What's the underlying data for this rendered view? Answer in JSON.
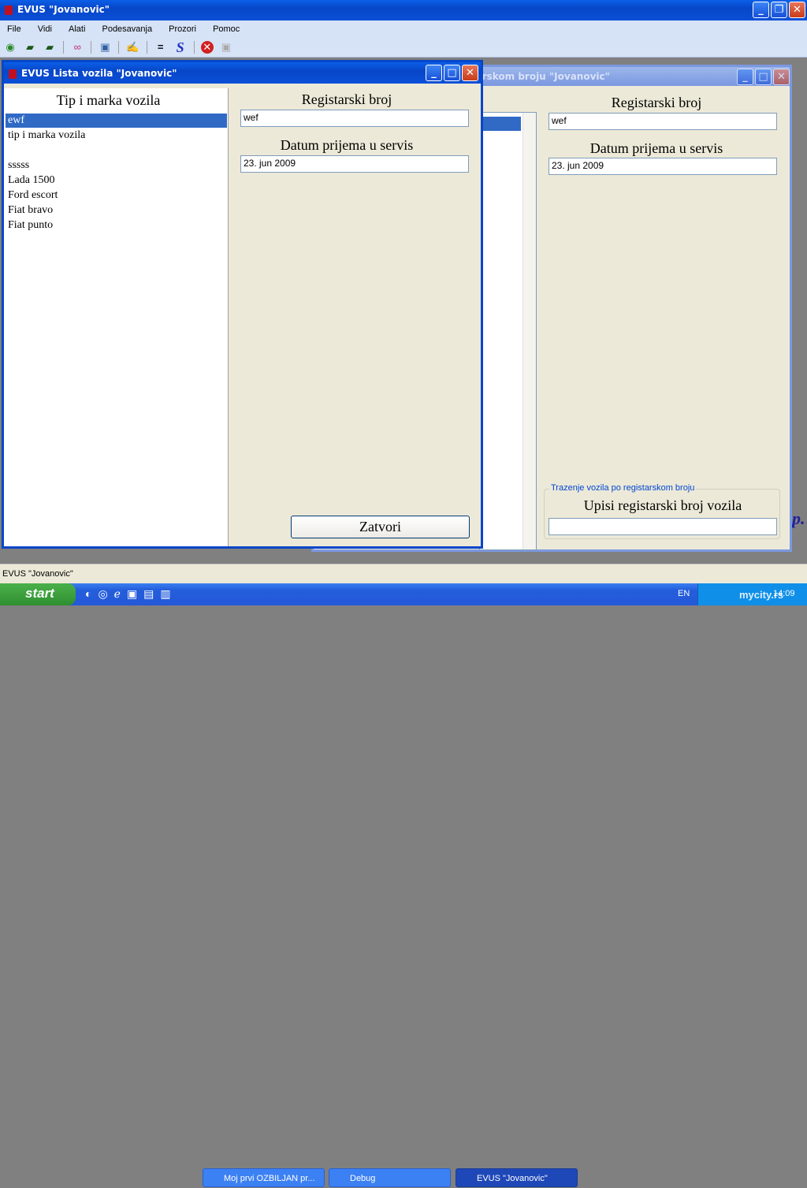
{
  "app": {
    "title": "EVUS \"Jovanovic\"",
    "status": "EVUS \"Jovanovic\""
  },
  "menu": [
    "File",
    "Vidi",
    "Alati",
    "Podesavanja",
    "Prozori",
    "Pomoc"
  ],
  "toolbar": [
    "car-eye-icon",
    "car-green-icon",
    "car-green-icon",
    "glasses-icon",
    "picture-icon",
    "hand-icon",
    "equals-icon",
    "s-logo-icon",
    "stop-icon",
    "picture-disabled-icon"
  ],
  "back_window": {
    "title": "...rskom broju \"Jovanovic\"",
    "reg_label": "Registarski broj",
    "reg_value": "wef",
    "date_label": "Datum prijema u servis",
    "date_value": "23. jun 2009",
    "group_legend": "Trazenje vozila po registarskom broju",
    "search_label": "Upisi registarski broj vozila",
    "search_value": ""
  },
  "front_window": {
    "title": "EVUS Lista vozila \"Jovanovic\"",
    "list_header": "Tip i marka vozila",
    "items": [
      "ewf",
      "tip i marka vozila",
      "",
      "sssss",
      "Lada 1500",
      "Ford escort",
      "Fiat bravo",
      "Fiat punto"
    ],
    "selected": 0,
    "reg_label": "Registarski broj",
    "reg_value": "wef",
    "date_label": "Datum prijema u servis",
    "date_value": "23. jun 2009",
    "close_button": "Zatvori"
  },
  "bg_text": "p.",
  "taskbar": {
    "start": "start",
    "tasks": [
      "Moj prvi OZBILJAN pr...",
      "Debug",
      "EVUS \"Jovanovic\""
    ],
    "lang": "EN",
    "clock": "14:09",
    "watermark": "mycity.rs"
  }
}
